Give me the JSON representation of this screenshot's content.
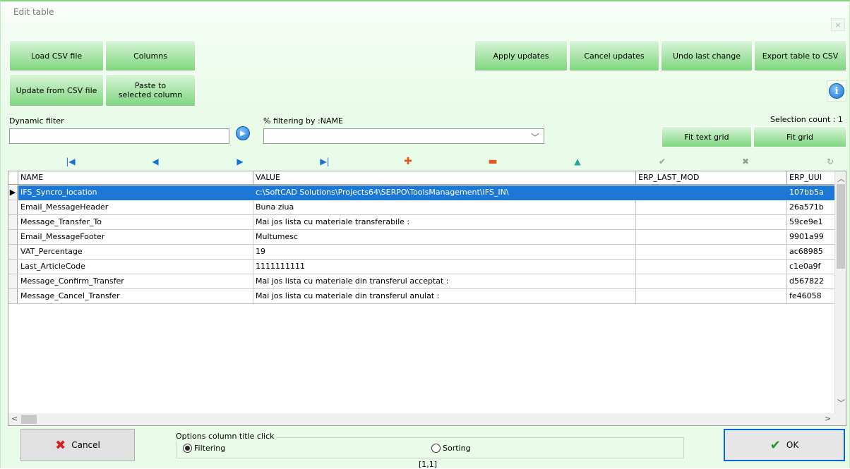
{
  "window": {
    "title": "Edit table",
    "close_glyph": "×"
  },
  "toolbar": {
    "load_csv": "Load CSV file",
    "columns": "Columns",
    "apply_updates": "Apply updates",
    "cancel_updates": "Cancel updates",
    "undo_last": "Undo last change",
    "export_csv": "Export table to CSV",
    "update_csv": "Update from CSV file",
    "paste_line1": "Paste to",
    "paste_line2": "selected column"
  },
  "filter": {
    "dynamic_label": "Dynamic filter",
    "dynamic_value": "",
    "percent_label": "% filtering by :NAME",
    "combo_value": "",
    "selection_count": "Selection count : 1",
    "fit_text_grid": "Fit text grid",
    "fit_grid": "Fit grid"
  },
  "navigator": {
    "icons": [
      "first-icon",
      "prior-icon",
      "next-icon",
      "last-icon",
      "insert-icon",
      "delete-icon",
      "edit-icon",
      "post-icon",
      "cancel-icon",
      "refresh-icon"
    ],
    "colors": {
      "blue": "#1a6fd0",
      "orange": "#e2571e",
      "teal": "#2aa0a0",
      "gray": "#9a9a9a"
    }
  },
  "grid": {
    "columns": [
      "NAME",
      "VALUE",
      "ERP_LAST_MOD",
      "ERP_UUI"
    ],
    "selected_row_color": "#1c78d4",
    "rows": [
      {
        "name": "IFS_Syncro_location",
        "value": "c:\\SoftCAD Solutions\\Projects64\\SERPO\\ToolsManagement\\IFS_IN\\",
        "mod": "",
        "uuid": "107bb5a"
      },
      {
        "name": "Email_MessageHeader",
        "value": "Buna ziua",
        "mod": "",
        "uuid": "26a571b"
      },
      {
        "name": "Message_Transfer_To",
        "value": "Mai jos lista cu materiale transferabile :",
        "mod": "",
        "uuid": "59ce9e1"
      },
      {
        "name": "Email_MessageFooter",
        "value": "Multumesc",
        "mod": "",
        "uuid": "9901a99"
      },
      {
        "name": "VAT_Percentage",
        "value": "19",
        "mod": "",
        "uuid": "ac68985"
      },
      {
        "name": "Last_ArticleCode",
        "value": "1111111111",
        "mod": "",
        "uuid": "c1e0a9f"
      },
      {
        "name": "Message_Confirm_Transfer",
        "value": "Mai jos lista cu materiale din transferul acceptat :",
        "mod": "",
        "uuid": "d567822"
      },
      {
        "name": "Message_Cancel_Transfer",
        "value": "Mai jos lista cu materiale din transferul anulat :",
        "mod": "",
        "uuid": "fe46058"
      }
    ]
  },
  "footer": {
    "cancel": "Cancel",
    "ok": "OK",
    "options_title": "Options column title click",
    "filtering": "Filtering",
    "sorting": "Sorting",
    "selected_option": "Filtering",
    "position": "[1,1]"
  }
}
